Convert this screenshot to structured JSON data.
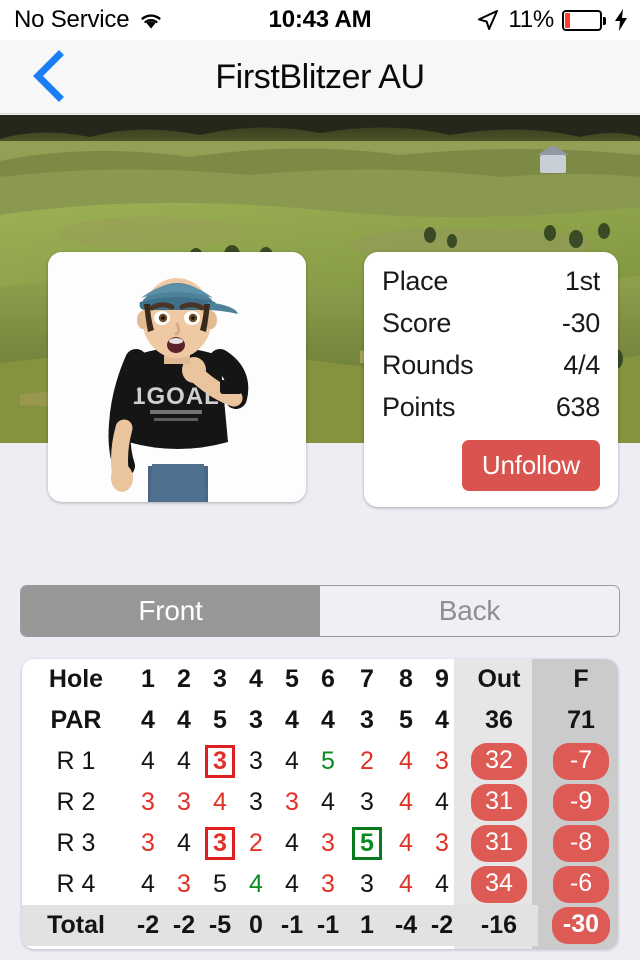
{
  "statusbar": {
    "carrier": "No Service",
    "wifi_icon": "wifi-icon",
    "time": "10:43 AM",
    "location_icon": "location-arrow-icon",
    "battery_percent": "11%",
    "battery_icon": "battery-low-icon",
    "charging_icon": "lightning-bolt-icon",
    "battery_level": 11,
    "battery_color": "#ff3b30"
  },
  "navbar": {
    "back_icon": "chevron-left-icon",
    "back_color": "#1a7ef4",
    "title": "FirstBlitzer AU"
  },
  "banner": {
    "image_name": "golf-course-photo"
  },
  "avatar": {
    "image_name": "player-avatar-photo",
    "shirt_text": "1GOAL"
  },
  "stats": {
    "rows": [
      {
        "label": "Place",
        "value": "1st"
      },
      {
        "label": "Score",
        "value": "-30"
      },
      {
        "label": "Rounds",
        "value": "4/4"
      },
      {
        "label": "Points",
        "value": "638"
      }
    ],
    "unfollow_label": "Unfollow",
    "unfollow_color": "#d9534f"
  },
  "segmented": {
    "front_label": "Front",
    "back_label": "Back",
    "selected": "Front"
  },
  "scorecard": {
    "header": {
      "label": "Hole",
      "holes": [
        "1",
        "2",
        "3",
        "4",
        "5",
        "6",
        "7",
        "8",
        "9"
      ],
      "out": "Out",
      "f": "F"
    },
    "par": {
      "label": "PAR",
      "values": [
        "4",
        "4",
        "5",
        "3",
        "4",
        "4",
        "3",
        "5",
        "4"
      ],
      "out": "36",
      "f": "71"
    },
    "rounds": [
      {
        "label": "R 1",
        "cells": [
          {
            "v": "4",
            "c": "black"
          },
          {
            "v": "4",
            "c": "black"
          },
          {
            "v": "3",
            "c": "red",
            "box": "red"
          },
          {
            "v": "3",
            "c": "black"
          },
          {
            "v": "4",
            "c": "black"
          },
          {
            "v": "5",
            "c": "green"
          },
          {
            "v": "2",
            "c": "red"
          },
          {
            "v": "4",
            "c": "red"
          },
          {
            "v": "3",
            "c": "red"
          }
        ],
        "out": "32",
        "f": "-7"
      },
      {
        "label": "R 2",
        "cells": [
          {
            "v": "3",
            "c": "red"
          },
          {
            "v": "3",
            "c": "red"
          },
          {
            "v": "4",
            "c": "red"
          },
          {
            "v": "3",
            "c": "black"
          },
          {
            "v": "3",
            "c": "red"
          },
          {
            "v": "4",
            "c": "black"
          },
          {
            "v": "3",
            "c": "black"
          },
          {
            "v": "4",
            "c": "red"
          },
          {
            "v": "4",
            "c": "black"
          }
        ],
        "out": "31",
        "f": "-9"
      },
      {
        "label": "R 3",
        "cells": [
          {
            "v": "3",
            "c": "red"
          },
          {
            "v": "4",
            "c": "black"
          },
          {
            "v": "3",
            "c": "red",
            "box": "red"
          },
          {
            "v": "2",
            "c": "red"
          },
          {
            "v": "4",
            "c": "black"
          },
          {
            "v": "3",
            "c": "red"
          },
          {
            "v": "5",
            "c": "green",
            "box": "green"
          },
          {
            "v": "4",
            "c": "red"
          },
          {
            "v": "3",
            "c": "red"
          }
        ],
        "out": "31",
        "f": "-8"
      },
      {
        "label": "R 4",
        "cells": [
          {
            "v": "4",
            "c": "black"
          },
          {
            "v": "3",
            "c": "red"
          },
          {
            "v": "5",
            "c": "black"
          },
          {
            "v": "4",
            "c": "green"
          },
          {
            "v": "4",
            "c": "black"
          },
          {
            "v": "3",
            "c": "red"
          },
          {
            "v": "3",
            "c": "black"
          },
          {
            "v": "4",
            "c": "red"
          },
          {
            "v": "4",
            "c": "black"
          }
        ],
        "out": "34",
        "f": "-6"
      }
    ],
    "total": {
      "label": "Total",
      "values": [
        "-2",
        "-2",
        "-5",
        "0",
        "-1",
        "-1",
        "1",
        "-4",
        "-2"
      ],
      "out": "-16",
      "f": "-30"
    },
    "pill_color": "#dd5a55",
    "over_par_color": "#e03127",
    "under_par_color": "#0a8a22"
  }
}
